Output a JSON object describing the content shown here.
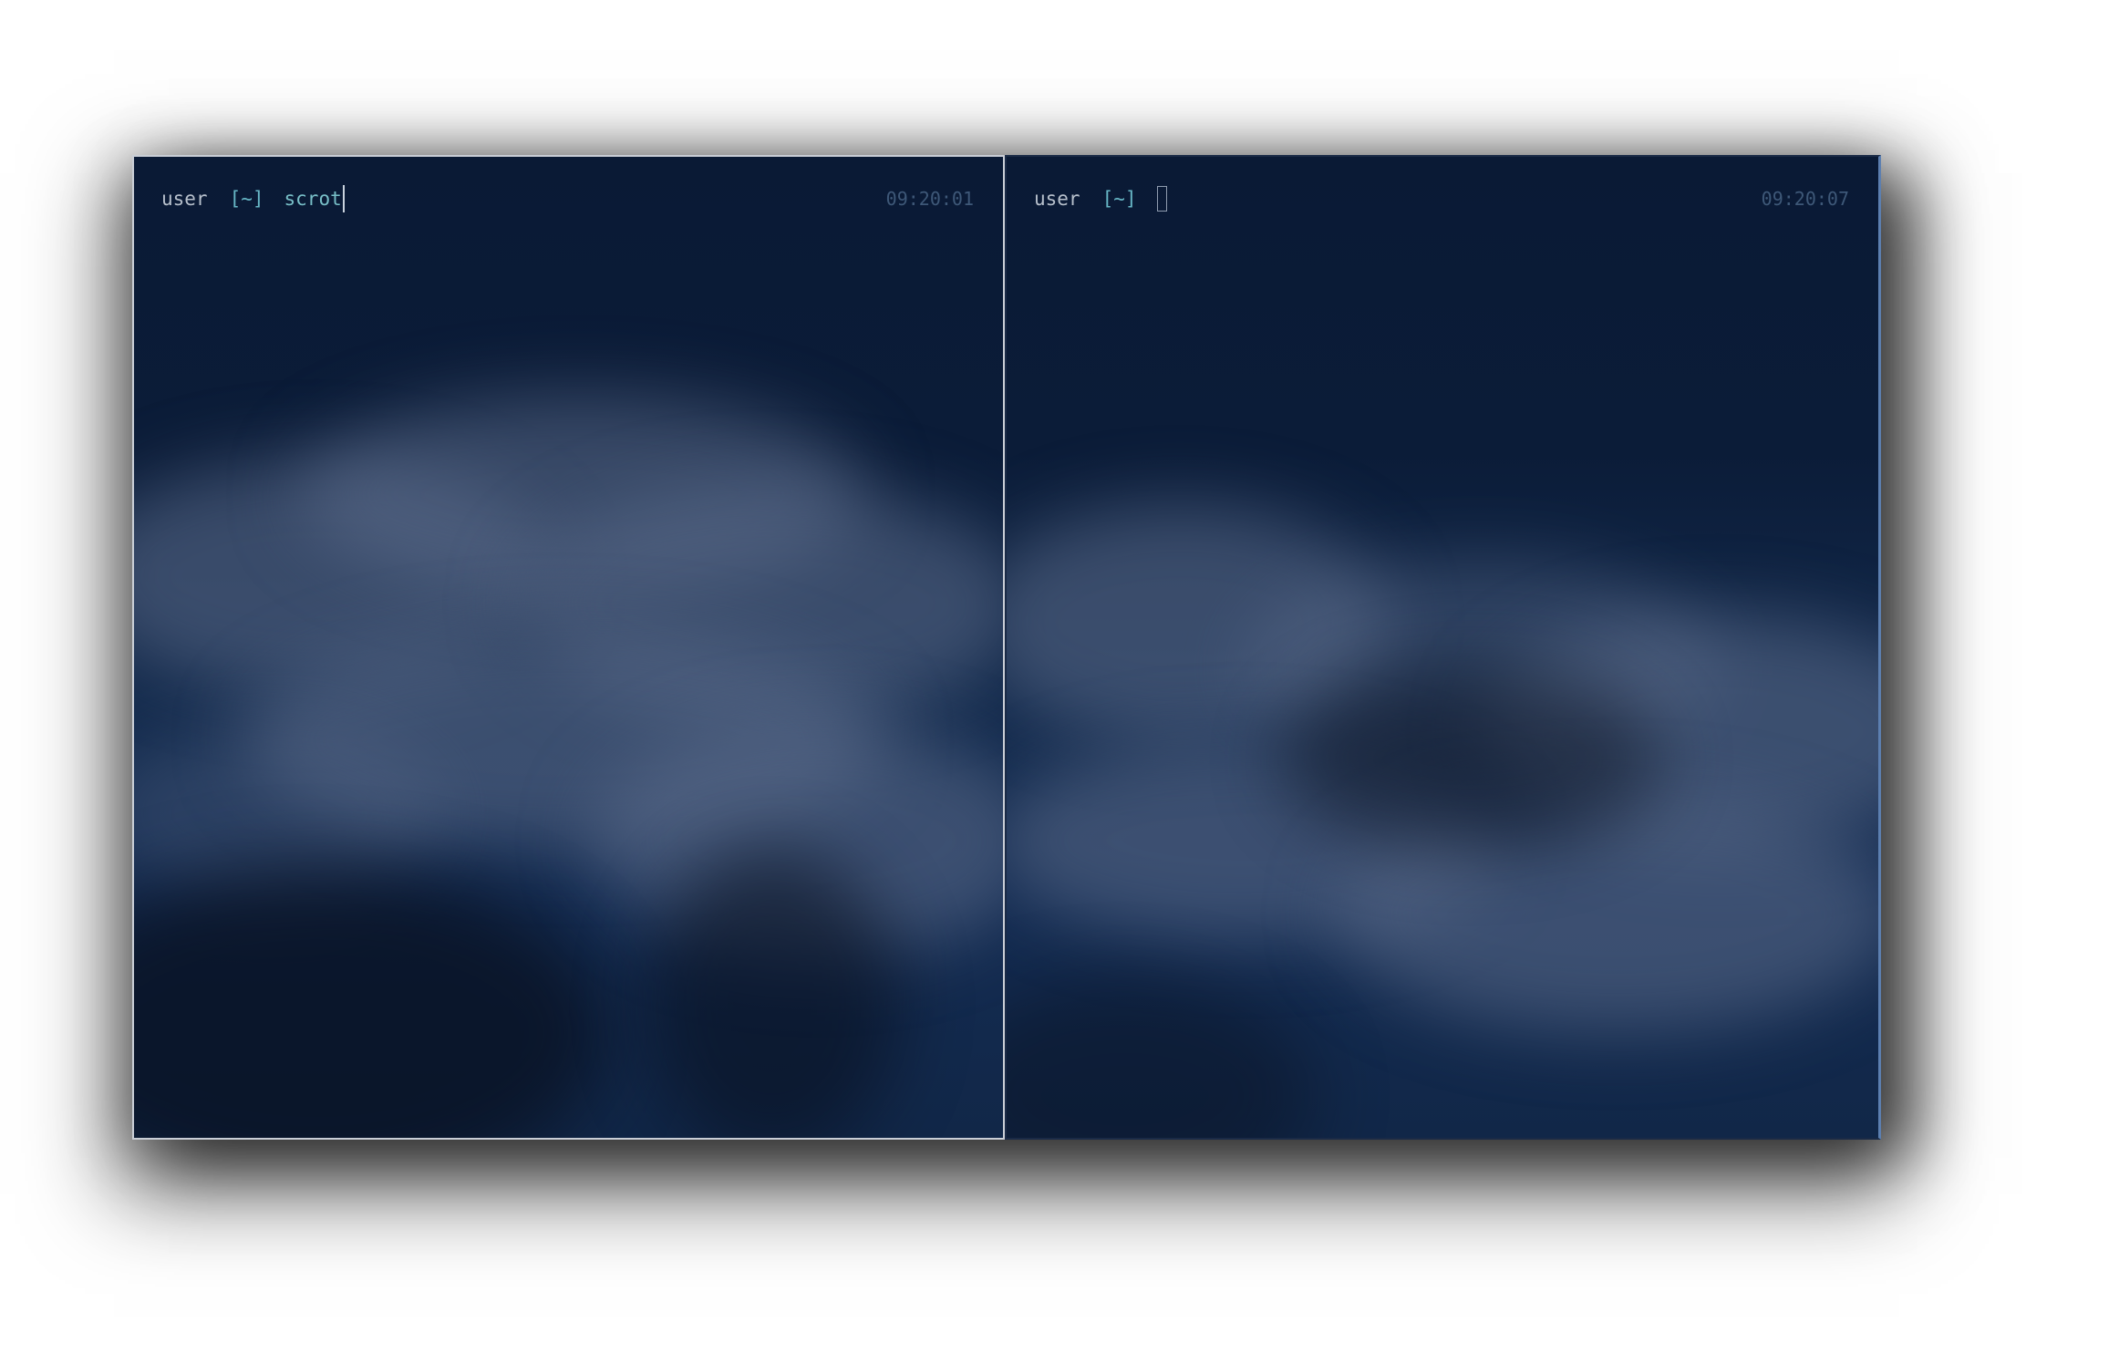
{
  "terminals": [
    {
      "user": "user",
      "dir": "[~]",
      "command": "scrot",
      "time": "09:20:01",
      "focused": true
    },
    {
      "user": "user",
      "dir": "[~]",
      "command": "",
      "time": "09:20:07",
      "focused": false
    }
  ],
  "colors": {
    "background": "#0b1a33",
    "prompt_user": "#b7c0cc",
    "prompt_dir": "#67b7c6",
    "prompt_command": "#78bfc8",
    "clock": "#3e5878",
    "focused_border": "#c9ced6"
  }
}
